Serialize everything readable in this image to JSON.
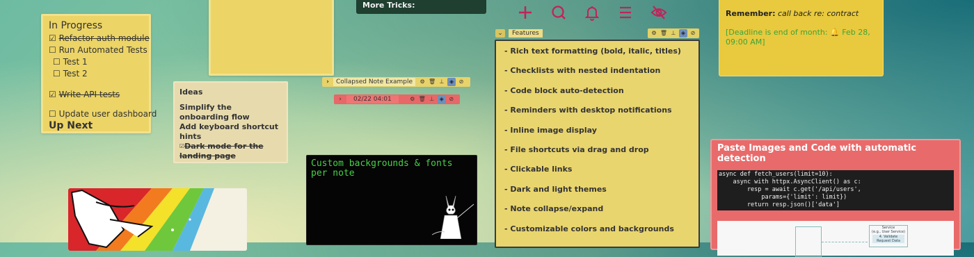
{
  "notes": {
    "in_progress": {
      "title": "In Progress",
      "items": [
        {
          "check": "☑",
          "label": "Refactor auth module"
        },
        {
          "check": "☐",
          "label": "Run Automated Tests"
        },
        {
          "check": "☐",
          "label": "Test 1"
        },
        {
          "check": "☐",
          "label": "Test 2"
        },
        {
          "check": "☑",
          "label": "Write API tests"
        },
        {
          "check": "☐",
          "label": "Update user dashboard"
        }
      ],
      "footer": "Up Next"
    },
    "ideas": {
      "title": "Ideas",
      "lines": [
        "Simplify the onboarding flow",
        "Add keyboard shortcut hints",
        "Dark mode for the landing page"
      ],
      "check": "☑"
    },
    "tricks": {
      "title": "More Tricks:"
    },
    "collapsed_example": {
      "label": "Collapsed Note Example",
      "chevron": "›"
    },
    "collapsed_date": {
      "label": "02/22 04:01",
      "chevron": "›"
    },
    "black": {
      "text": "Custom backgrounds & fonts per note"
    },
    "features": {
      "label": "Features",
      "chevron": "⌄",
      "items": [
        "- Rich text formatting (bold, italic, titles)",
        "- Checklists with nested indentation",
        "- Code block auto-detection",
        "- Reminders with desktop notifications",
        "- Inline image display",
        "- File shortcuts via drag and drop",
        "- Clickable links",
        "- Dark and light themes",
        "- Note collapse/expand",
        "- Customizable colors and backgrounds"
      ]
    },
    "remember": {
      "lead": "Remember:",
      "text": "call back re: contract",
      "deadline": "[Deadline is end of month: 🔔 Feb 28, 09:00 AM]"
    },
    "paste": {
      "title": "Paste Images and Code with automatic detection",
      "code": "async def fetch_users(limit=10):\n    async with httpx.AsyncClient() as c:\n        resp = await c.get('/api/users',\n            params={'limit': limit})\n        return resp.json()['data']",
      "diagram_title": "Service",
      "diagram_sub": "(e.g., User Service)",
      "diagram_step": "4. Validate Request Data"
    }
  },
  "toolbar_icons": [
    "gear-icon",
    "trash-icon",
    "pin-icon",
    "layers-icon",
    "eye-off-icon"
  ],
  "top_actions": [
    "plus-icon",
    "search-icon",
    "bell-icon",
    "menu-icon",
    "eye-off-icon"
  ],
  "colors": {
    "note_yellow": "#ecd466",
    "note_red": "#e96a6a",
    "accent_icons": "#c0245a",
    "code_green": "#46d246",
    "tricks_bg": "#1f3f30"
  }
}
